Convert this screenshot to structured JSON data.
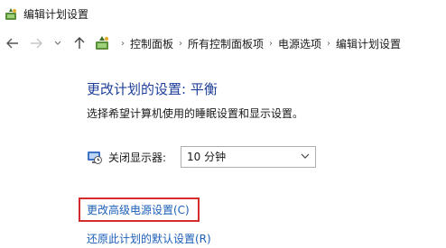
{
  "window": {
    "title": "编辑计划设置",
    "icon": "power-options-icon"
  },
  "nav": {
    "back_icon": "arrow-left-icon",
    "forward_icon": "arrow-right-icon",
    "recent_icon": "chevron-down-icon",
    "up_icon": "arrow-up-icon",
    "breadcrumb": [
      "控制面板",
      "所有控制面板项",
      "电源选项",
      "编辑计划设置"
    ]
  },
  "main": {
    "title": "更改计划的设置: 平衡",
    "description": "选择希望计算机使用的睡眠设置和显示设置。",
    "display_off": {
      "label": "关闭显示器:",
      "value": "10 分钟",
      "icon": "monitor-clock-icon"
    },
    "links": {
      "advanced": "更改高级电源设置(C)",
      "restore": "还原此计划的默认设置(R)"
    }
  },
  "colors": {
    "title": "#1e3f9a",
    "link": "#1c5fb8",
    "highlight": "#d62b2b"
  }
}
